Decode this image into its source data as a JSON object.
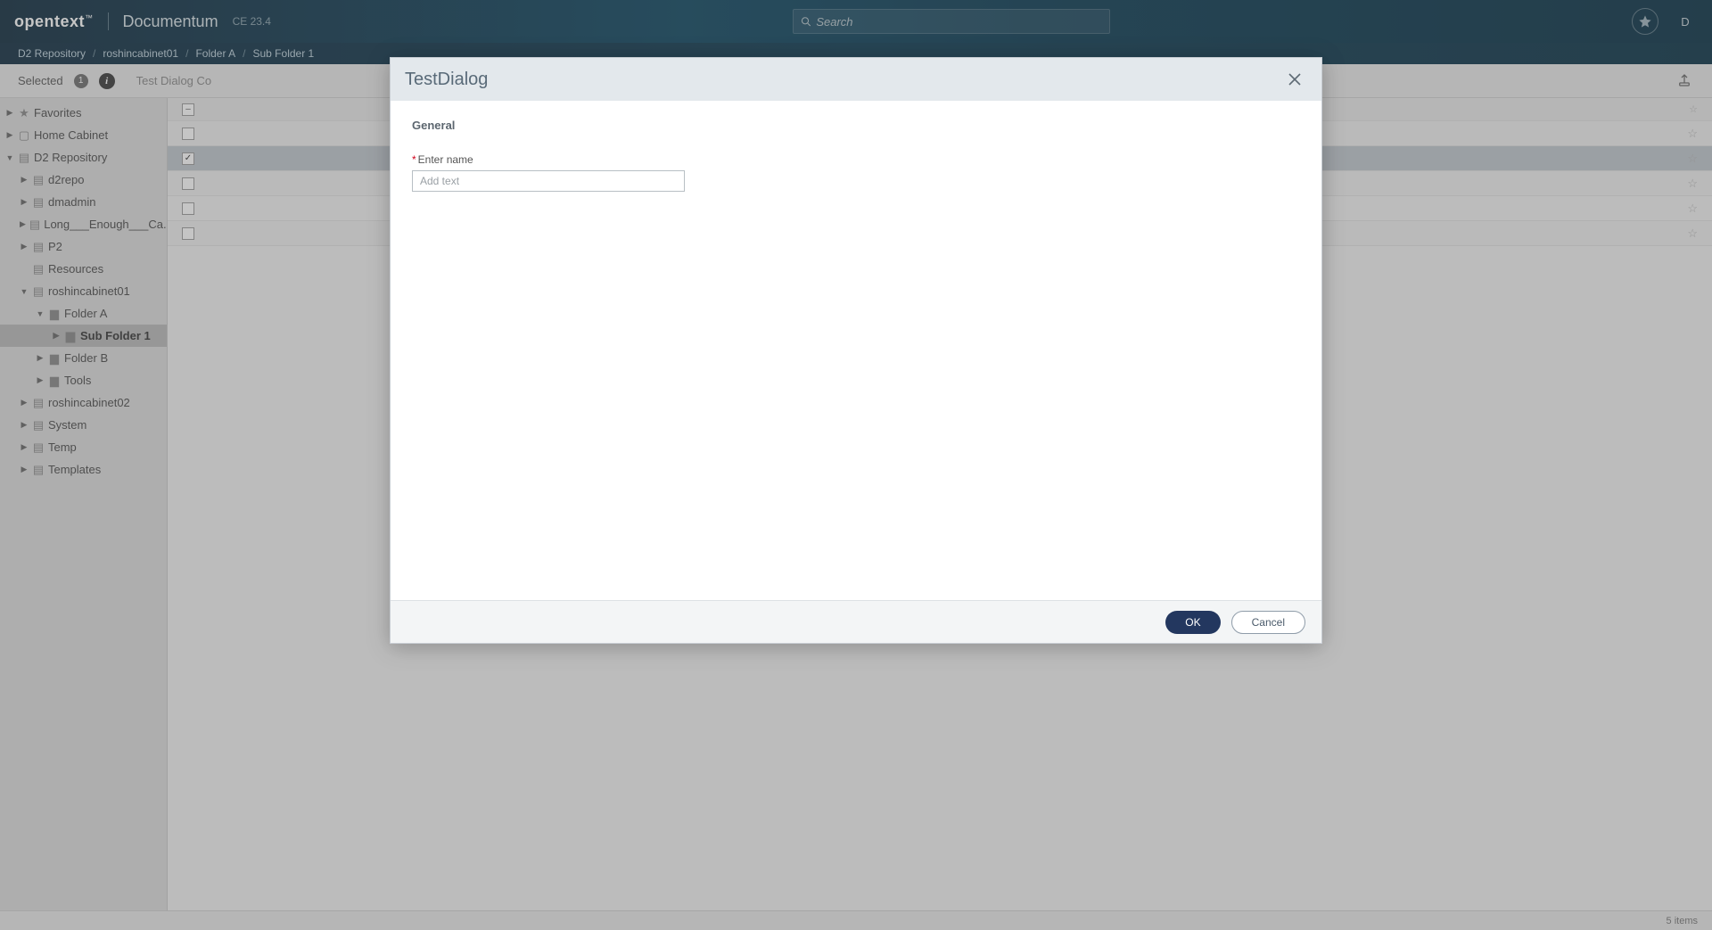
{
  "header": {
    "brand_main": "opentext",
    "brand_tm": "™",
    "brand_app": "Documentum",
    "brand_version": "CE 23.4",
    "search_placeholder": "Search",
    "avatar_initial": "D"
  },
  "breadcrumbs": [
    "D2 Repository",
    "roshincabinet01",
    "Folder A",
    "Sub Folder 1"
  ],
  "selectionbar": {
    "label": "Selected",
    "count": "1",
    "context_title": "Test Dialog Co"
  },
  "tree": {
    "favorites": "Favorites",
    "home_cabinet": "Home Cabinet",
    "d2_repository": "D2 Repository",
    "items_level1": [
      "d2repo",
      "dmadmin",
      "Long___Enough___Ca...",
      "P2",
      "Resources",
      "roshincabinet01",
      "roshincabinet02",
      "System",
      "Temp",
      "Templates"
    ],
    "folder_a": "Folder A",
    "sub_folder_1": "Sub Folder 1",
    "folder_b": "Folder B",
    "tools": "Tools"
  },
  "list": {
    "rows": [
      {
        "checked": false
      },
      {
        "checked": true
      },
      {
        "checked": false
      },
      {
        "checked": false
      },
      {
        "checked": false
      }
    ]
  },
  "footer": {
    "items_text": "5 items"
  },
  "dialog": {
    "title": "TestDialog",
    "section": "General",
    "field_label": "Enter name",
    "field_placeholder": "Add text",
    "ok": "OK",
    "cancel": "Cancel"
  }
}
